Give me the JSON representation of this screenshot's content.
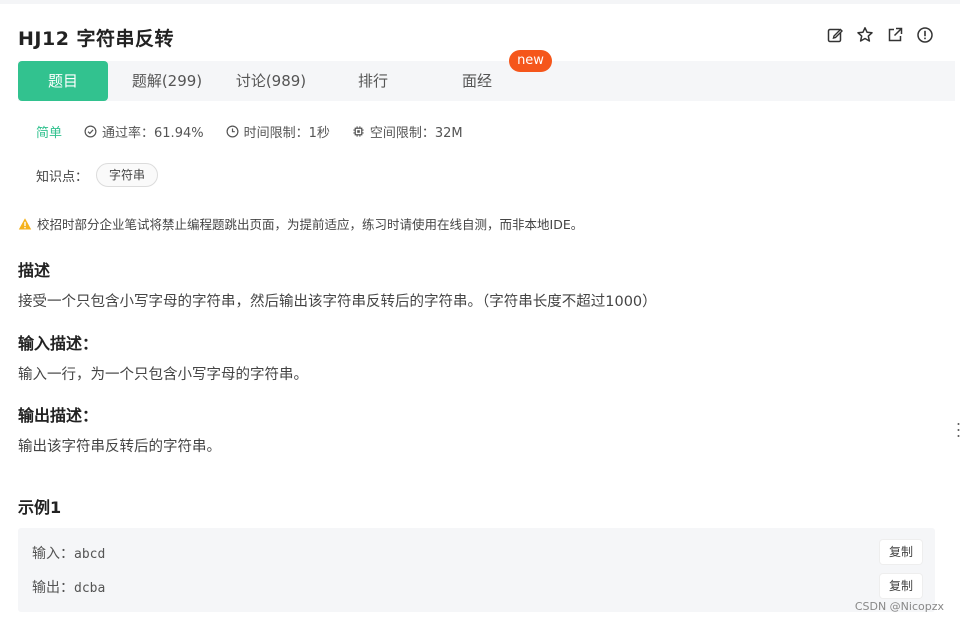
{
  "problem": {
    "title": "HJ12  字符串反转"
  },
  "toolbar": {
    "icons": [
      "edit-icon",
      "star-icon",
      "external-link-icon",
      "report-icon"
    ]
  },
  "tabs": [
    {
      "label": "题目",
      "active": true
    },
    {
      "label": "题解(299)",
      "active": false
    },
    {
      "label": "讨论(989)",
      "active": false
    },
    {
      "label": "排行",
      "active": false
    },
    {
      "label": "面经",
      "active": false
    }
  ],
  "badge": "new",
  "meta": {
    "difficulty": "简单",
    "pass_rate": "通过率：61.94%",
    "time_limit": "时间限制：1秒",
    "memory_limit": "空间限制：32M"
  },
  "knowledge": {
    "label": "知识点：",
    "tags": [
      "字符串"
    ]
  },
  "notice": "校招时部分企业笔试将禁止编程题跳出页面，为提前适应，练习时请使用在线自测，而非本地IDE。",
  "sections": {
    "desc_title": "描述",
    "desc_text": "接受一个只包含小写字母的字符串，然后输出该字符串反转后的字符串。（字符串长度不超过1000）",
    "input_title": "输入描述：",
    "input_text": "输入一行，为一个只包含小写字母的字符串。",
    "output_title": "输出描述：",
    "output_text": "输出该字符串反转后的字符串。"
  },
  "example": {
    "title": "示例1",
    "input_label": "输入：",
    "input_value": "abcd",
    "output_label": "输出：",
    "output_value": "dcba",
    "copy_label": "复制"
  },
  "watermark": "CSDN @Nicopzx",
  "colors": {
    "accent": "#32c28f",
    "badge": "#f5561b"
  }
}
